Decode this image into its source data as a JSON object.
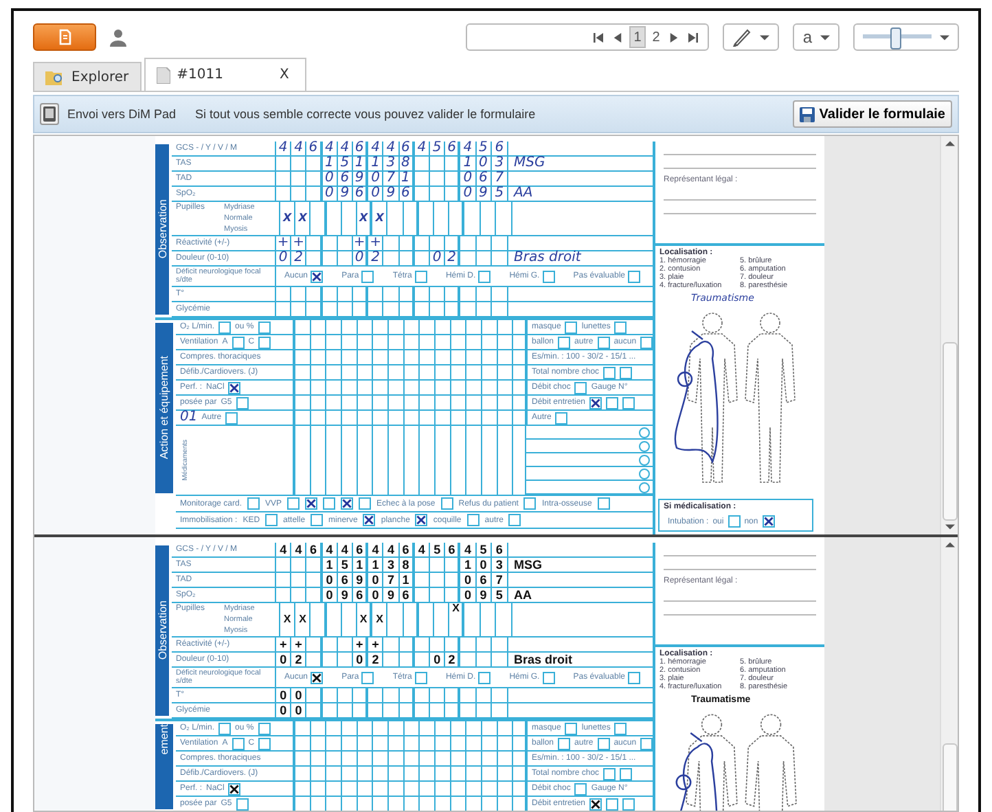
{
  "toolbar": {
    "pages": [
      {
        "label": "1",
        "selected": true
      },
      {
        "label": "2",
        "selected": false
      }
    ],
    "font_menu": "a",
    "zoom": {
      "level": 0.45
    }
  },
  "tabs": [
    {
      "label": "Explorer",
      "selected": false,
      "kind": "explorer"
    },
    {
      "label": "#1011",
      "selected": true,
      "kind": "document",
      "close": "X"
    }
  ],
  "infobar": {
    "send_button": "Envoi vers DiM Pad",
    "message": "Si tout vous semble correcte vous pouvez valider le formulaire",
    "validate_button": "Valider le formulaie"
  },
  "pages": [
    {
      "observation": {
        "title": "Observation",
        "rows": [
          {
            "kind": "cells",
            "label": "GCS - / Y / V / M",
            "cells": [
              "4",
              "4",
              "6",
              "4",
              "4",
              "6",
              "4",
              "4",
              "6",
              "4",
              "5",
              "6",
              "4",
              "5",
              "6"
            ]
          },
          {
            "kind": "cells",
            "label": "TAS",
            "cells": [
              null,
              null,
              null,
              "1",
              "5",
              "1",
              "1",
              "3",
              "8",
              null,
              null,
              null,
              "1",
              "0",
              "3"
            ],
            "note": "MSG"
          },
          {
            "kind": "cells",
            "label": "TAD",
            "cells": [
              null,
              null,
              null,
              "0",
              "6",
              "9",
              "0",
              "7",
              "1",
              null,
              null,
              null,
              "0",
              "6",
              "7"
            ]
          },
          {
            "kind": "cells",
            "label": "SpO₂",
            "cells": [
              null,
              null,
              null,
              "0",
              "9",
              "6",
              "0",
              "9",
              "6",
              null,
              null,
              null,
              "0",
              "9",
              "5"
            ],
            "note": "AA"
          },
          {
            "kind": "pupils",
            "label": "Pupilles",
            "subrows": [
              {
                "label": "Mydriase",
                "cells": [
                  null,
                  null,
                  null,
                  null,
                  null,
                  null,
                  null,
                  null,
                  null,
                  null,
                  null,
                  null,
                  null,
                  null,
                  null
                ]
              },
              {
                "label": "Normale",
                "cells": [
                  "X",
                  "X",
                  null,
                  null,
                  null,
                  "X",
                  "X",
                  null,
                  null,
                  null,
                  null,
                  null,
                  null,
                  null,
                  null
                ]
              },
              {
                "label": "Myosis",
                "cells": [
                  null,
                  null,
                  null,
                  null,
                  null,
                  null,
                  null,
                  null,
                  null,
                  null,
                  null,
                  null,
                  null,
                  null,
                  null
                ]
              }
            ]
          },
          {
            "kind": "cells",
            "label": "Réactivité (+/-)",
            "cells": [
              "+",
              "+",
              null,
              null,
              null,
              "+",
              "+",
              null,
              null,
              null,
              null,
              null,
              null,
              null,
              null
            ]
          },
          {
            "kind": "cells",
            "label": "Douleur (0-10)",
            "cells": [
              "0",
              "2",
              null,
              null,
              null,
              "0",
              "2",
              null,
              null,
              null,
              "0",
              "2",
              null,
              null,
              null
            ],
            "note": "Bras droit"
          },
          {
            "kind": "options",
            "label": "Déficit neurologique focal s/dte",
            "options": [
              {
                "label": "Aucun",
                "checked": true
              },
              {
                "label": "Para",
                "checked": false
              },
              {
                "label": "Tétra",
                "checked": false
              },
              {
                "label": "Hémi D.",
                "checked": false
              },
              {
                "label": "Hémi G.",
                "checked": false
              },
              {
                "label": "Pas évaluable",
                "checked": false
              }
            ]
          },
          {
            "kind": "cells",
            "label": "T°",
            "cells": [
              null,
              null,
              null,
              null,
              null,
              null,
              null,
              null,
              null,
              null,
              null,
              null,
              null,
              null,
              null
            ]
          },
          {
            "kind": "cells",
            "label": "Glycémie",
            "cells": [
              null,
              null,
              null,
              null,
              null,
              null,
              null,
              null,
              null,
              null,
              null,
              null,
              null,
              null,
              null
            ]
          }
        ]
      },
      "action": {
        "title": "Action et équipement",
        "rows": [
          {
            "left": [
              {
                "kind": "text",
                "text": "O₂ L/min."
              },
              {
                "kind": "box",
                "checked": false
              },
              {
                "kind": "text",
                "text": "ou %"
              },
              {
                "kind": "box",
                "checked": false
              }
            ],
            "right": [
              {
                "kind": "text",
                "text": "masque"
              },
              {
                "kind": "box",
                "checked": false
              },
              {
                "kind": "text",
                "text": "lunettes"
              },
              {
                "kind": "box",
                "checked": false
              }
            ]
          },
          {
            "left": [
              {
                "kind": "text",
                "text": "Ventilation"
              },
              {
                "kind": "text",
                "text": "A"
              },
              {
                "kind": "box",
                "checked": false
              },
              {
                "kind": "text",
                "text": "C"
              },
              {
                "kind": "box",
                "checked": false
              }
            ],
            "right": [
              {
                "kind": "text",
                "text": "ballon"
              },
              {
                "kind": "box",
                "checked": false
              },
              {
                "kind": "text",
                "text": "autre"
              },
              {
                "kind": "box",
                "checked": false
              },
              {
                "kind": "text",
                "text": "aucun"
              },
              {
                "kind": "box",
                "checked": false
              }
            ]
          },
          {
            "left": [
              {
                "kind": "text",
                "text": "Compres. thoraciques"
              }
            ],
            "right": [
              {
                "kind": "text",
                "text": "Es/min. : 100 - 30/2 - 15/1 ..."
              }
            ]
          },
          {
            "left": [
              {
                "kind": "text",
                "text": "Défib./Cardiovers. (J)"
              }
            ],
            "right": [
              {
                "kind": "text",
                "text": "Total nombre choc"
              },
              {
                "kind": "box",
                "checked": false
              },
              {
                "kind": "box",
                "checked": false
              }
            ]
          },
          {
            "left": [
              {
                "kind": "text",
                "text": "Perf. :"
              },
              {
                "kind": "text",
                "text": "NaCl"
              },
              {
                "kind": "box",
                "checked": true
              }
            ],
            "right": [
              {
                "kind": "text",
                "text": "Débit choc"
              },
              {
                "kind": "box",
                "checked": false
              },
              {
                "kind": "text",
                "text": "Gauge N°"
              }
            ]
          },
          {
            "left": [
              {
                "kind": "text",
                "text": "posée par"
              },
              {
                "kind": "text",
                "text": "G5"
              },
              {
                "kind": "box",
                "checked": false
              }
            ],
            "right": [
              {
                "kind": "text",
                "text": "Débit entretien"
              },
              {
                "kind": "box",
                "checked": true
              },
              {
                "kind": "box",
                "checked": false
              },
              {
                "kind": "box",
                "checked": false
              }
            ]
          },
          {
            "left": [
              {
                "kind": "hand",
                "text": "01"
              },
              {
                "kind": "text",
                "text": "Autre"
              },
              {
                "kind": "box",
                "checked": false
              }
            ],
            "right": [
              {
                "kind": "text",
                "text": "Autre"
              },
              {
                "kind": "box",
                "checked": false
              }
            ]
          }
        ],
        "medication_label": "Médicaments"
      },
      "footer_rows": [
        [
          {
            "kind": "text",
            "text": "Monitorage card."
          },
          {
            "kind": "box",
            "checked": false
          },
          {
            "kind": "text",
            "text": "VVP"
          },
          {
            "kind": "box",
            "checked": false
          },
          {
            "kind": "box",
            "checked": true
          },
          {
            "kind": "box",
            "checked": false
          },
          {
            "kind": "box",
            "checked": true
          },
          {
            "kind": "box",
            "checked": false
          },
          {
            "kind": "text",
            "text": "Echec à la pose"
          },
          {
            "kind": "box",
            "checked": false
          },
          {
            "kind": "text",
            "text": "Refus du patient"
          },
          {
            "kind": "box",
            "checked": false
          },
          {
            "kind": "text",
            "text": "Intra-osseuse"
          },
          {
            "kind": "box",
            "checked": false
          }
        ],
        [
          {
            "kind": "text",
            "text": "Immobilisation :"
          },
          {
            "kind": "text",
            "text": "KED"
          },
          {
            "kind": "box",
            "checked": false
          },
          {
            "kind": "text",
            "text": "attelle"
          },
          {
            "kind": "box",
            "checked": false
          },
          {
            "kind": "text",
            "text": "minerve"
          },
          {
            "kind": "box",
            "checked": true
          },
          {
            "kind": "text",
            "text": "planche"
          },
          {
            "kind": "box",
            "checked": true
          },
          {
            "kind": "text",
            "text": "coquille"
          },
          {
            "kind": "box",
            "checked": false
          },
          {
            "kind": "text",
            "text": "autre"
          },
          {
            "kind": "box",
            "checked": false
          }
        ]
      ],
      "right": {
        "legal": "Représentant légal :",
        "localisation": "Localisation :",
        "legend": [
          "1. hémorragie",
          "2. contusion",
          "3. plaie",
          "4. fracture/luxation",
          "5. brûlure",
          "6. amputation",
          "7. douleur",
          "8. paresthésie"
        ],
        "body_note": "Traumatisme",
        "medicalisation": {
          "title": "Si médicalisation :",
          "parts": [
            {
              "kind": "text",
              "text": "Intubation :"
            },
            {
              "kind": "text",
              "text": "oui"
            },
            {
              "kind": "box",
              "checked": false
            },
            {
              "kind": "text",
              "text": "non"
            },
            {
              "kind": "box",
              "checked": true
            }
          ]
        }
      }
    },
    {
      "observation": {
        "title": "Observation",
        "rows": [
          {
            "kind": "cells",
            "label": "GCS - / Y / V / M",
            "cells": [
              "4",
              "4",
              "6",
              "4",
              "4",
              "6",
              "4",
              "4",
              "6",
              "4",
              "5",
              "6",
              "4",
              "5",
              "6"
            ]
          },
          {
            "kind": "cells",
            "label": "TAS",
            "cells": [
              null,
              null,
              null,
              "1",
              "5",
              "1",
              "1",
              "3",
              "8",
              null,
              null,
              null,
              "1",
              "0",
              "3"
            ],
            "note": "MSG"
          },
          {
            "kind": "cells",
            "label": "TAD",
            "cells": [
              null,
              null,
              null,
              "0",
              "6",
              "9",
              "0",
              "7",
              "1",
              null,
              null,
              null,
              "0",
              "6",
              "7"
            ]
          },
          {
            "kind": "cells",
            "label": "SpO₂",
            "cells": [
              null,
              null,
              null,
              "0",
              "9",
              "6",
              "0",
              "9",
              "6",
              null,
              null,
              null,
              "0",
              "9",
              "5"
            ],
            "note": "AA"
          },
          {
            "kind": "pupils",
            "label": "Pupilles",
            "subrows": [
              {
                "label": "Mydriase",
                "cells": [
                  null,
                  null,
                  null,
                  null,
                  null,
                  null,
                  null,
                  null,
                  null,
                  null,
                  null,
                  "X",
                  null,
                  null,
                  null
                ]
              },
              {
                "label": "Normale",
                "cells": [
                  "X",
                  "X",
                  null,
                  null,
                  null,
                  "X",
                  "X",
                  null,
                  null,
                  null,
                  null,
                  null,
                  null,
                  null,
                  null
                ]
              },
              {
                "label": "Myosis",
                "cells": [
                  null,
                  null,
                  null,
                  null,
                  null,
                  null,
                  null,
                  null,
                  null,
                  null,
                  null,
                  null,
                  null,
                  null,
                  null
                ]
              }
            ]
          },
          {
            "kind": "cells",
            "label": "Réactivité (+/-)",
            "cells": [
              "+",
              "+",
              null,
              null,
              null,
              "+",
              "+",
              null,
              null,
              null,
              null,
              null,
              null,
              null,
              null
            ]
          },
          {
            "kind": "cells",
            "label": "Douleur (0-10)",
            "cells": [
              "0",
              "2",
              null,
              null,
              null,
              "0",
              "2",
              null,
              null,
              null,
              "0",
              "2",
              null,
              null,
              null
            ],
            "note": "Bras droit"
          },
          {
            "kind": "options",
            "label": "Déficit neurologique focal s/dte",
            "options": [
              {
                "label": "Aucun",
                "checked": true
              },
              {
                "label": "Para",
                "checked": false
              },
              {
                "label": "Tétra",
                "checked": false
              },
              {
                "label": "Hémi D.",
                "checked": false
              },
              {
                "label": "Hémi G.",
                "checked": false
              },
              {
                "label": "Pas évaluable",
                "checked": false
              }
            ]
          },
          {
            "kind": "cells",
            "label": "T°",
            "cells": [
              "0",
              "0",
              null,
              null,
              null,
              null,
              null,
              null,
              null,
              null,
              null,
              null,
              null,
              null,
              null
            ]
          },
          {
            "kind": "cells",
            "label": "Glycémie",
            "cells": [
              "0",
              "0",
              null,
              null,
              null,
              null,
              null,
              null,
              null,
              null,
              null,
              null,
              null,
              null,
              null
            ]
          }
        ]
      },
      "action": {
        "title": "ement",
        "rows": [
          {
            "left": [
              {
                "kind": "text",
                "text": "O₂ L/min."
              },
              {
                "kind": "box",
                "checked": false
              },
              {
                "kind": "text",
                "text": "ou %"
              },
              {
                "kind": "box",
                "checked": false
              }
            ],
            "right": [
              {
                "kind": "text",
                "text": "masque"
              },
              {
                "kind": "box",
                "checked": false
              },
              {
                "kind": "text",
                "text": "lunettes"
              },
              {
                "kind": "box",
                "checked": false
              }
            ]
          },
          {
            "left": [
              {
                "kind": "text",
                "text": "Ventilation"
              },
              {
                "kind": "text",
                "text": "A"
              },
              {
                "kind": "box",
                "checked": false
              },
              {
                "kind": "text",
                "text": "C"
              },
              {
                "kind": "box",
                "checked": false
              }
            ],
            "right": [
              {
                "kind": "text",
                "text": "ballon"
              },
              {
                "kind": "box",
                "checked": false
              },
              {
                "kind": "text",
                "text": "autre"
              },
              {
                "kind": "box",
                "checked": false
              },
              {
                "kind": "text",
                "text": "aucun"
              },
              {
                "kind": "box",
                "checked": false
              }
            ]
          },
          {
            "left": [
              {
                "kind": "text",
                "text": "Compres. thoraciques"
              }
            ],
            "right": [
              {
                "kind": "text",
                "text": "Es/min. : 100 - 30/2 - 15/1 ..."
              }
            ]
          },
          {
            "left": [
              {
                "kind": "text",
                "text": "Défib./Cardiovers. (J)"
              }
            ],
            "right": [
              {
                "kind": "text",
                "text": "Total nombre choc"
              },
              {
                "kind": "box",
                "checked": false
              },
              {
                "kind": "box",
                "checked": false
              }
            ]
          },
          {
            "left": [
              {
                "kind": "text",
                "text": "Perf. :"
              },
              {
                "kind": "text",
                "text": "NaCl"
              },
              {
                "kind": "box",
                "checked": true
              }
            ],
            "right": [
              {
                "kind": "text",
                "text": "Débit choc"
              },
              {
                "kind": "box",
                "checked": false
              },
              {
                "kind": "text",
                "text": "Gauge N°"
              }
            ]
          },
          {
            "left": [
              {
                "kind": "text",
                "text": "posée par"
              },
              {
                "kind": "text",
                "text": "G5"
              },
              {
                "kind": "box",
                "checked": false
              }
            ],
            "right": [
              {
                "kind": "text",
                "text": "Débit entretien"
              },
              {
                "kind": "box",
                "checked": true
              },
              {
                "kind": "box",
                "checked": false
              },
              {
                "kind": "box",
                "checked": false
              }
            ]
          }
        ]
      },
      "right": {
        "legal": "Représentant légal :",
        "localisation": "Localisation :",
        "legend": [
          "1. hémorragie",
          "2. contusion",
          "3. plaie",
          "4. fracture/luxation",
          "5. brûlure",
          "6. amputation",
          "7. douleur",
          "8. paresthésie"
        ],
        "body_note": "Traumatisme"
      }
    }
  ]
}
